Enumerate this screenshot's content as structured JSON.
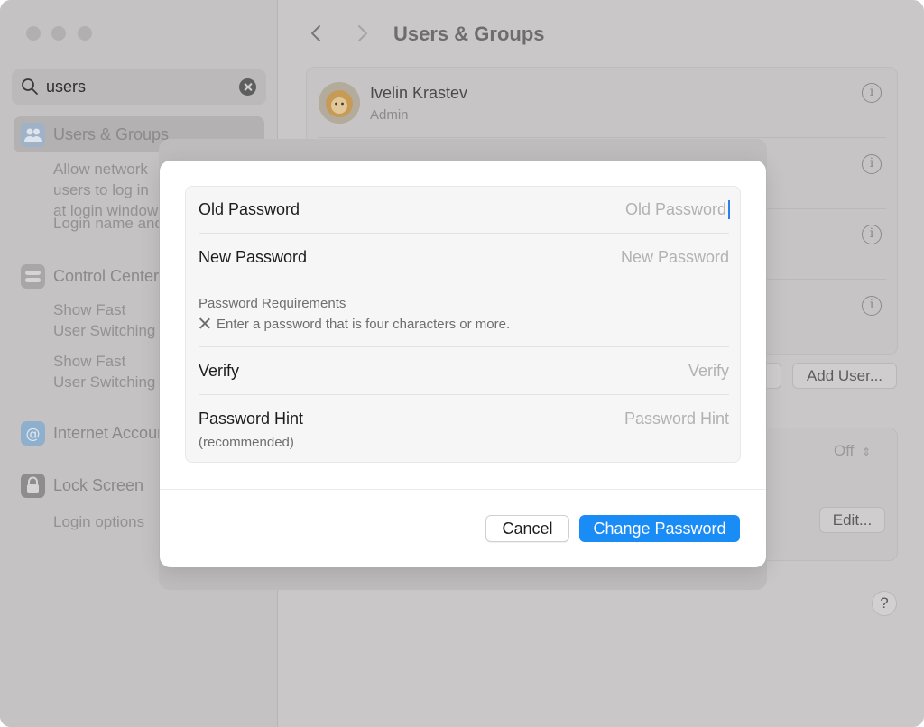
{
  "sidebar": {
    "search": {
      "value": "users"
    },
    "items": [
      {
        "label": "Users & Groups",
        "subs": [
          "Allow network users to log in at login window",
          "Login name and password"
        ]
      },
      {
        "label": "Control Center",
        "subs": [
          "Show Fast User Switching in Control Center",
          "Show Fast User Switching in the menu bar"
        ]
      },
      {
        "label": "Internet Accounts",
        "subs": []
      },
      {
        "label": "Lock Screen",
        "subs": [
          "Login options"
        ]
      }
    ]
  },
  "main": {
    "title": "Users & Groups",
    "user": {
      "name": "Ivelin Krastev",
      "role": "Admin"
    },
    "add_user_label": "Add User...",
    "off_label": "Off",
    "edit_label": "Edit...",
    "help_label": "?"
  },
  "dialog": {
    "old_password": {
      "label": "Old Password",
      "placeholder": "Old Password"
    },
    "new_password": {
      "label": "New Password",
      "placeholder": "New Password"
    },
    "requirements": {
      "title": "Password Requirements",
      "rule": "Enter a password that is four characters or more."
    },
    "verify": {
      "label": "Verify",
      "placeholder": "Verify"
    },
    "hint": {
      "label": "Password Hint",
      "sublabel": "(recommended)",
      "placeholder": "Password Hint"
    },
    "cancel_label": "Cancel",
    "submit_label": "Change Password"
  },
  "colors": {
    "accent": "#1a8cf6",
    "caret": "#2a7ef0"
  }
}
